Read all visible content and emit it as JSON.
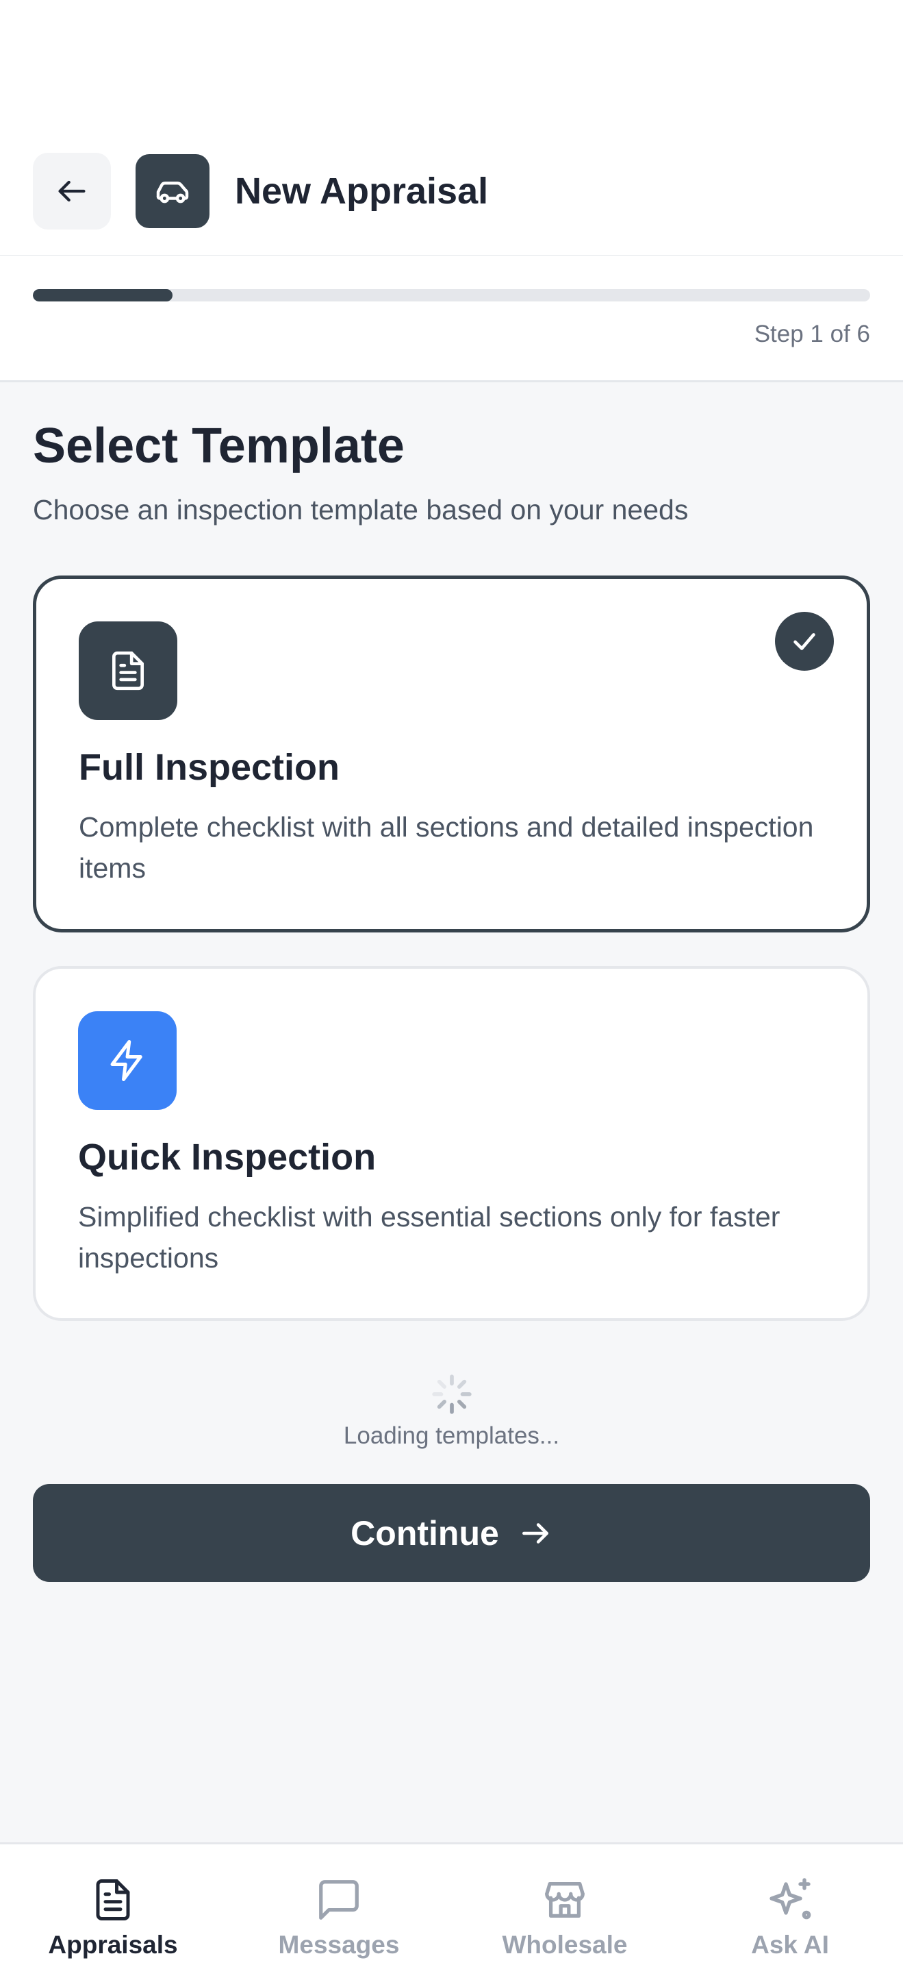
{
  "header": {
    "title": "New Appraisal",
    "back_icon": "arrow-left-icon",
    "brand_icon": "car-icon"
  },
  "progress": {
    "current_step": 1,
    "total_steps": 6,
    "fraction": 0.1667,
    "label": "Step 1 of 6"
  },
  "section": {
    "title": "Select Template",
    "subtitle": "Choose an inspection template based on your needs"
  },
  "templates": [
    {
      "title": "Full Inspection",
      "description": "Complete checklist with all sections and detailed inspection items",
      "icon": "document-icon",
      "icon_color": "#37434d",
      "selected": true
    },
    {
      "title": "Quick Inspection",
      "description": "Simplified checklist with essential sections only for faster inspections",
      "icon": "lightning-icon",
      "icon_color": "#3b82f6",
      "selected": false
    }
  ],
  "loading": {
    "text": "Loading templates..."
  },
  "continue_button": {
    "label": "Continue"
  },
  "tabbar": {
    "items": [
      {
        "label": "Appraisals",
        "icon": "document-icon",
        "active": true
      },
      {
        "label": "Messages",
        "icon": "message-icon",
        "active": false
      },
      {
        "label": "Wholesale",
        "icon": "store-icon",
        "active": false
      },
      {
        "label": "Ask AI",
        "icon": "sparkle-icon",
        "active": false
      }
    ]
  },
  "colors": {
    "primary": "#37434d",
    "accent_blue": "#3b82f6",
    "background": "#f6f7f9",
    "muted_text": "#6b7280",
    "inactive_tab": "#9ca3af"
  }
}
